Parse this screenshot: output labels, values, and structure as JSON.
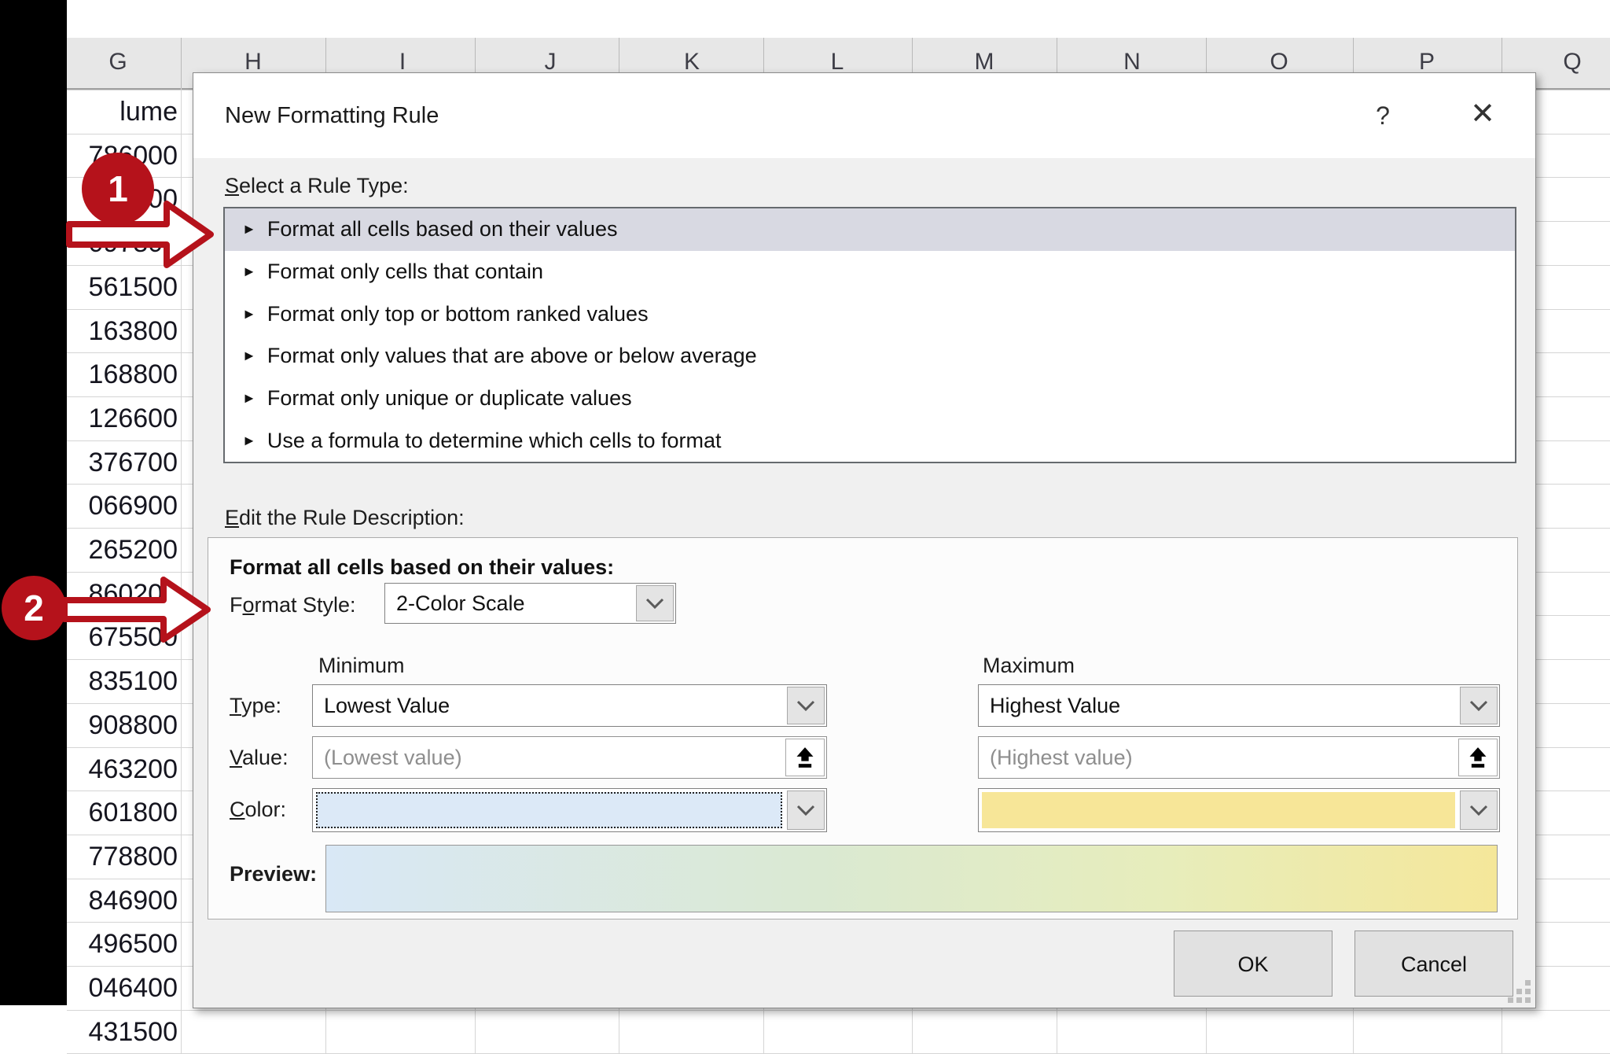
{
  "window": {
    "title": "New Formatting Rule",
    "help_glyph": "?",
    "close_glyph": "✕"
  },
  "spreadsheet": {
    "column_headers": [
      "G",
      "H",
      "I",
      "J",
      "K",
      "L",
      "M",
      "N",
      "O",
      "P",
      "Q"
    ],
    "g_column_header_partial": "lume",
    "g_column_values": [
      "786000",
      "900",
      "097800",
      "561500",
      "163800",
      "168800",
      "126600",
      "376700",
      "066900",
      "265200",
      "860200",
      "675500",
      "835100",
      "908800",
      "463200",
      "601800",
      "778800",
      "846900",
      "496500",
      "046400",
      "431500"
    ]
  },
  "dialog": {
    "rule_type": {
      "label": {
        "text": "Select a Rule Type:",
        "key": "S"
      },
      "items": [
        "Format all cells based on their values",
        "Format only cells that contain",
        "Format only top or bottom ranked values",
        "Format only values that are above or below average",
        "Format only unique or duplicate values",
        "Use a formula to determine which cells to format"
      ],
      "selected_index": 0
    },
    "description": {
      "label": {
        "text": "Edit the Rule Description:",
        "key": "E"
      },
      "heading": "Format all cells based on their values:",
      "format_style": {
        "label": {
          "text": "Format Style:",
          "key": "o"
        },
        "value": "2-Color Scale"
      },
      "columns": {
        "minimum": "Minimum",
        "maximum": "Maximum"
      },
      "type_row": {
        "label": {
          "text": "Type:",
          "key": "T"
        },
        "minimum_value": "Lowest Value",
        "maximum_value": "Highest Value"
      },
      "value_row": {
        "label": {
          "text": "Value:",
          "key": "V"
        },
        "minimum_placeholder": "(Lowest value)",
        "maximum_placeholder": "(Highest value)"
      },
      "color_row": {
        "label": {
          "text": "Color:",
          "key": "C"
        },
        "minimum_hex": "#dce9f7",
        "maximum_hex": "#f7e698"
      },
      "preview": {
        "label": "Preview:",
        "gradient": [
          "#d9e8f6",
          "#dae9d2",
          "#e7edbb",
          "#f5e79a"
        ]
      }
    },
    "buttons": {
      "ok": "OK",
      "cancel": "Cancel"
    }
  },
  "annotations": {
    "step1": "1",
    "step2": "2"
  },
  "colors": {
    "annotation_red": "#b5121b",
    "selected_rule_bg": "#d8d9e2",
    "min_color_swatch": "#dce9f7",
    "max_color_swatch": "#f7e698"
  }
}
